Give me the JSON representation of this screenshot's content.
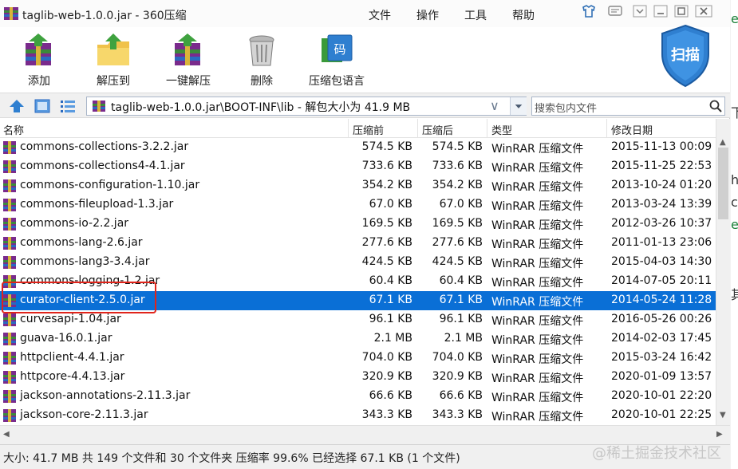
{
  "window": {
    "title": "taglib-web-1.0.0.jar - 360压缩",
    "menu": [
      "文件",
      "操作",
      "工具",
      "帮助"
    ]
  },
  "toolbar": {
    "add": "添加",
    "extract_to": "解压到",
    "one_click_extract": "一键解压",
    "delete": "删除",
    "language": "压缩包语言",
    "scan": "扫描"
  },
  "address": {
    "path": "taglib-web-1.0.0.jar\\BOOT-INF\\lib - 解包大小为 41.9 MB",
    "search_placeholder": "搜索包内文件"
  },
  "columns": {
    "name": "名称",
    "packed": "压缩前",
    "size": "压缩后",
    "type": "类型",
    "modified": "修改日期"
  },
  "files": [
    {
      "name": "commons-collections-3.2.2.jar",
      "packed": "574.5 KB",
      "size": "574.5 KB",
      "type": "WinRAR 压缩文件",
      "modified": "2015-11-13 00:09"
    },
    {
      "name": "commons-collections4-4.1.jar",
      "packed": "733.6 KB",
      "size": "733.6 KB",
      "type": "WinRAR 压缩文件",
      "modified": "2015-11-25 22:53"
    },
    {
      "name": "commons-configuration-1.10.jar",
      "packed": "354.2 KB",
      "size": "354.2 KB",
      "type": "WinRAR 压缩文件",
      "modified": "2013-10-24 01:20"
    },
    {
      "name": "commons-fileupload-1.3.jar",
      "packed": "67.0 KB",
      "size": "67.0 KB",
      "type": "WinRAR 压缩文件",
      "modified": "2013-03-24 13:39"
    },
    {
      "name": "commons-io-2.2.jar",
      "packed": "169.5 KB",
      "size": "169.5 KB",
      "type": "WinRAR 压缩文件",
      "modified": "2012-03-26 10:37"
    },
    {
      "name": "commons-lang-2.6.jar",
      "packed": "277.6 KB",
      "size": "277.6 KB",
      "type": "WinRAR 压缩文件",
      "modified": "2011-01-13 23:06"
    },
    {
      "name": "commons-lang3-3.4.jar",
      "packed": "424.5 KB",
      "size": "424.5 KB",
      "type": "WinRAR 压缩文件",
      "modified": "2015-04-03 14:30"
    },
    {
      "name": "commons-logging-1.2.jar",
      "packed": "60.4 KB",
      "size": "60.4 KB",
      "type": "WinRAR 压缩文件",
      "modified": "2014-07-05 20:11"
    },
    {
      "name": "curator-client-2.5.0.jar",
      "packed": "67.1 KB",
      "size": "67.1 KB",
      "type": "WinRAR 压缩文件",
      "modified": "2014-05-24 11:28",
      "selected": true
    },
    {
      "name": "curvesapi-1.04.jar",
      "packed": "96.1 KB",
      "size": "96.1 KB",
      "type": "WinRAR 压缩文件",
      "modified": "2016-05-26 00:26"
    },
    {
      "name": "guava-16.0.1.jar",
      "packed": "2.1 MB",
      "size": "2.1 MB",
      "type": "WinRAR 压缩文件",
      "modified": "2014-02-03 17:45"
    },
    {
      "name": "httpclient-4.4.1.jar",
      "packed": "704.0 KB",
      "size": "704.0 KB",
      "type": "WinRAR 压缩文件",
      "modified": "2015-03-24 16:42"
    },
    {
      "name": "httpcore-4.4.13.jar",
      "packed": "320.9 KB",
      "size": "320.9 KB",
      "type": "WinRAR 压缩文件",
      "modified": "2020-01-09 13:57"
    },
    {
      "name": "jackson-annotations-2.11.3.jar",
      "packed": "66.6 KB",
      "size": "66.6 KB",
      "type": "WinRAR 压缩文件",
      "modified": "2020-10-01 22:20"
    },
    {
      "name": "jackson-core-2.11.3.jar",
      "packed": "343.3 KB",
      "size": "343.3 KB",
      "type": "WinRAR 压缩文件",
      "modified": "2020-10-01 22:25"
    }
  ],
  "status": "大小: 41.7 MB 共 149 个文件和 30 个文件夹 压缩率 99.6% 已经选择 67.1 KB (1 个文件)",
  "watermark": "@稀土掘金技术社区",
  "background_window": {
    "chars": [
      "e",
      "下",
      "h",
      "c",
      "e",
      "其"
    ]
  },
  "colors": {
    "selection": "#0a6fd6",
    "highlight_border": "#e0241b",
    "scan_shield": "#2f7fd0"
  }
}
